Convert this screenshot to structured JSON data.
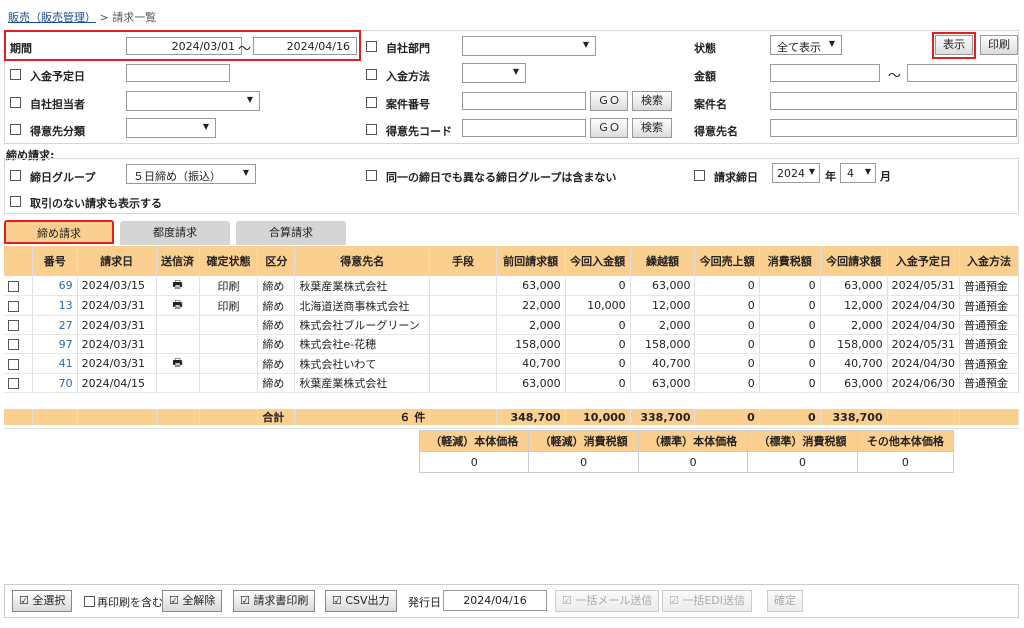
{
  "breadcrumb": {
    "parent": "販売（販売管理）",
    "sep": ">",
    "current": "請求一覧"
  },
  "filters": {
    "period_label": "期間",
    "period_from": "2024/03/01",
    "period_tilde": "〜",
    "period_to": "2024/04/16",
    "dept_label": "自社部門",
    "status_label": "状態",
    "status_value": "全て表示",
    "show_button": "表示",
    "print_button": "印刷",
    "due_label": "入金予定日",
    "pay_method_label": "入金方法",
    "amount_label": "金額",
    "amount_tilde": "〜",
    "staff_label": "自社担当者",
    "case_no_label": "案件番号",
    "go_label": "ＧＯ",
    "search_label": "検索",
    "case_name_label": "案件名",
    "cust_class_label": "得意先分類",
    "cust_code_label": "得意先コード",
    "cust_name_label": "得意先名"
  },
  "closing": {
    "section_label": "締め請求:",
    "group_label": "締日グループ",
    "group_value": "５日締め（振込）",
    "exclude_label": "同一の締日でも異なる締日グループは含まない",
    "closing_date_label": "請求締日",
    "year_value": "2024",
    "year_unit": "年",
    "month_value": "4",
    "month_unit": "月",
    "no_txn_label": "取引のない請求も表示する"
  },
  "tabs": [
    "締め請求",
    "都度請求",
    "合算請求"
  ],
  "table": {
    "headers": [
      "番号",
      "請求日",
      "送信済",
      "確定状態",
      "区分",
      "得意先名",
      "手段",
      "前回請求額",
      "今回入金額",
      "繰越額",
      "今回売上額",
      "消費税額",
      "今回請求額",
      "入金予定日",
      "入金方法"
    ],
    "rows": [
      {
        "no": "69",
        "date": "2024/03/15",
        "sent": "🖶",
        "status": "印刷",
        "kubun": "締め",
        "customer": "秋葉産業株式会社",
        "prev": "63,000",
        "paid": "0",
        "carry": "63,000",
        "sales": "0",
        "tax": "0",
        "bill": "63,000",
        "due": "2024/05/31",
        "method": "普通預金"
      },
      {
        "no": "13",
        "date": "2024/03/31",
        "sent": "🖶",
        "status": "印刷",
        "kubun": "締め",
        "customer": "北海道送商事株式会社",
        "prev": "22,000",
        "paid": "10,000",
        "carry": "12,000",
        "sales": "0",
        "tax": "0",
        "bill": "12,000",
        "due": "2024/04/30",
        "method": "普通預金"
      },
      {
        "no": "27",
        "date": "2024/03/31",
        "sent": "",
        "status": "",
        "kubun": "締め",
        "customer": "株式会社ブルーグリーン",
        "prev": "2,000",
        "paid": "0",
        "carry": "2,000",
        "sales": "0",
        "tax": "0",
        "bill": "2,000",
        "due": "2024/04/30",
        "method": "普通預金"
      },
      {
        "no": "97",
        "date": "2024/03/31",
        "sent": "",
        "status": "",
        "kubun": "締め",
        "customer": "株式会社e-花穂",
        "prev": "158,000",
        "paid": "0",
        "carry": "158,000",
        "sales": "0",
        "tax": "0",
        "bill": "158,000",
        "due": "2024/05/31",
        "method": "普通預金"
      },
      {
        "no": "41",
        "date": "2024/03/31",
        "sent": "🖶",
        "status": "",
        "kubun": "締め",
        "customer": "株式会社いわて",
        "prev": "40,700",
        "paid": "0",
        "carry": "40,700",
        "sales": "0",
        "tax": "0",
        "bill": "40,700",
        "due": "2024/04/30",
        "method": "普通預金"
      },
      {
        "no": "70",
        "date": "2024/04/15",
        "sent": "",
        "status": "",
        "kubun": "締め",
        "customer": "秋葉産業株式会社",
        "prev": "63,000",
        "paid": "0",
        "carry": "63,000",
        "sales": "0",
        "tax": "0",
        "bill": "63,000",
        "due": "2024/06/30",
        "method": "普通預金"
      }
    ],
    "summary": {
      "label": "合計",
      "count": "６ 件",
      "prev": "348,700",
      "paid": "10,000",
      "carry": "338,700",
      "sales": "0",
      "tax": "0",
      "bill": "338,700"
    }
  },
  "tax_table": {
    "headers": [
      "（軽減）本体価格",
      "（軽減）消費税額",
      "（標準）本体価格",
      "（標準）消費税額",
      "その他本体価格"
    ],
    "values": [
      "0",
      "0",
      "0",
      "0",
      "0"
    ]
  },
  "footer": {
    "select_all": "全選択",
    "reprint_label": "再印刷を含む",
    "clear_all": "全解除",
    "print_invoice": "請求書印刷",
    "csv_output": "CSV出力",
    "issue_date_label": "発行日",
    "issue_date_value": "2024/04/16",
    "bulk_mail": "一括メール送信",
    "bulk_edi": "一括EDI送信",
    "confirm": "確定"
  },
  "colors": {
    "header_bg": "#fbcf8f",
    "highlight": "#e02020",
    "link": "#1f6bb3"
  }
}
